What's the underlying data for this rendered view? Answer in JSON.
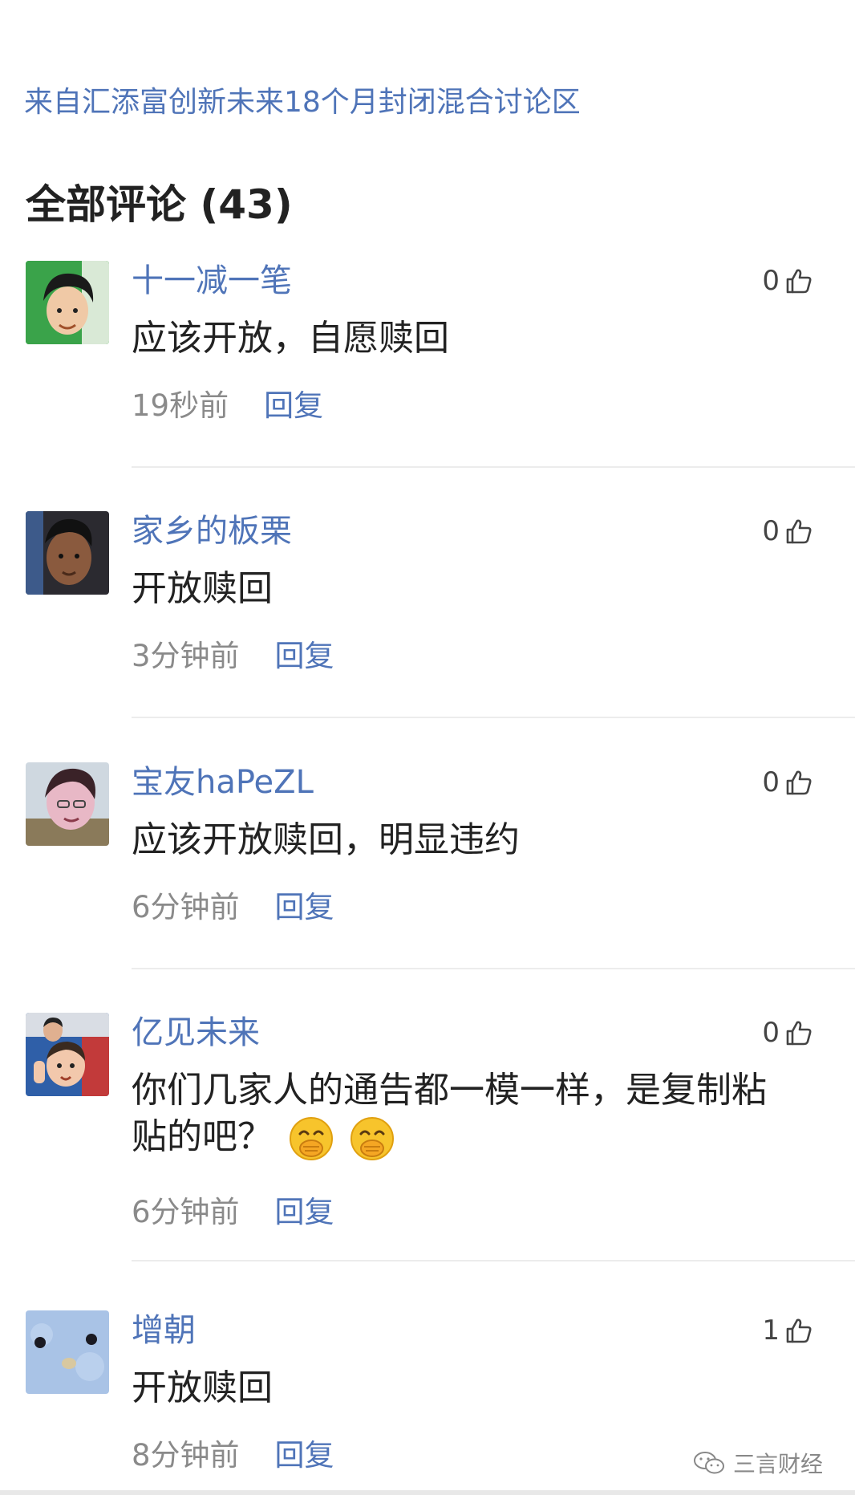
{
  "source": {
    "text": "来自汇添富创新未来18个月封闭混合讨论区"
  },
  "comments_header": {
    "title": "全部评论 (43)"
  },
  "comments": [
    {
      "username": "十一减一笔",
      "text": "应该开放，自愿赎回",
      "time": "19秒前",
      "reply": "回复",
      "likes": "0"
    },
    {
      "username": "家乡的板栗",
      "text": "开放赎回",
      "time": "3分钟前",
      "reply": "回复",
      "likes": "0"
    },
    {
      "username": "宝友haPeZL",
      "text": "应该开放赎回，明显违约",
      "time": "6分钟前",
      "reply": "回复",
      "likes": "0"
    },
    {
      "username": "亿见未来",
      "text_line1": "你们几家人的通告都一模一样，是复制粘",
      "text_line2": "贴的吧？",
      "time": "6分钟前",
      "reply": "回复",
      "likes": "0"
    },
    {
      "username": "增朝",
      "text": "开放赎回",
      "time": "8分钟前",
      "reply": "回复",
      "likes": "1"
    }
  ],
  "watermark": {
    "text": "三言财经"
  },
  "colors": {
    "link": "#4f74b8",
    "text": "#222222",
    "meta": "#8a8a8a",
    "divider": "#ececec"
  }
}
